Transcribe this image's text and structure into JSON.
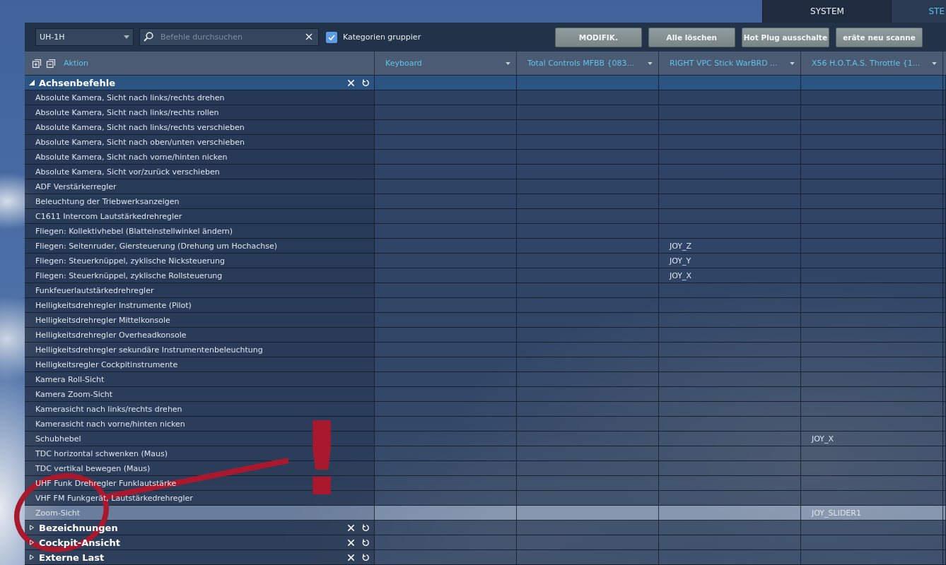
{
  "top_tabs": [
    {
      "label": "SYSTEM",
      "selected": false
    },
    {
      "label": "STE",
      "selected": true
    }
  ],
  "toolbar": {
    "aircraft": "UH-1H",
    "search": {
      "placeholder": "Befehle durchsuchen"
    },
    "group_categories": {
      "label": "Kategorien gruppier",
      "checked": true
    },
    "buttons": [
      "MODIFIK.",
      "Alle löschen",
      "Hot Plug ausschalte",
      "eräte neu scanne"
    ]
  },
  "table": {
    "columns": [
      {
        "label": "Aktion",
        "kind": "action"
      },
      {
        "label": "Keyboard",
        "kind": "device"
      },
      {
        "label": "Total Controls MFBB {083...",
        "kind": "device"
      },
      {
        "label": "RIGHT VPC Stick WarBRD ...",
        "kind": "device"
      },
      {
        "label": "X56 H.O.T.A.S. Throttle {1...",
        "kind": "device"
      }
    ],
    "categories": [
      {
        "name": "Achsenbefehle",
        "expanded": true,
        "rows": [
          {
            "action": "Absolute Kamera, Sicht nach links/rechts drehen",
            "selected": false
          },
          {
            "action": "Absolute Kamera, Sicht nach links/rechts rollen",
            "selected": false
          },
          {
            "action": "Absolute Kamera, Sicht nach links/rechts verschieben",
            "selected": false
          },
          {
            "action": "Absolute Kamera, Sicht nach oben/unten verschieben",
            "selected": false
          },
          {
            "action": "Absolute Kamera, Sicht nach vorne/hinten nicken",
            "selected": false
          },
          {
            "action": "Absolute Kamera, Sicht vor/zurück verschieben",
            "selected": false
          },
          {
            "action": "ADF Verstärkerregler",
            "selected": false
          },
          {
            "action": "Beleuchtung der Triebwerksanzeigen",
            "selected": false
          },
          {
            "action": "C1611 Intercom Lautstärkedrehregler",
            "selected": false
          },
          {
            "action": "Fliegen: Kollektivhebel (Blatteinstellwinkel ändern)",
            "selected": false
          },
          {
            "action": "Fliegen: Seitenruder, Giersteuerung (Drehung um Hochachse)",
            "selected": false,
            "bindings": [
              {
                "kind": "none"
              },
              {
                "kind": "none"
              },
              {
                "kind": "binding",
                "value": "JOY_Z"
              },
              {
                "kind": "none"
              }
            ]
          },
          {
            "action": "Fliegen: Steuerknüppel, zyklische Nicksteuerung",
            "selected": false,
            "bindings": [
              {
                "kind": "none"
              },
              {
                "kind": "none"
              },
              {
                "kind": "binding",
                "value": "JOY_Y"
              },
              {
                "kind": "none"
              }
            ]
          },
          {
            "action": "Fliegen: Steuerknüppel, zyklische Rollsteuerung",
            "selected": false,
            "bindings": [
              {
                "kind": "none"
              },
              {
                "kind": "none"
              },
              {
                "kind": "binding",
                "value": "JOY_X"
              },
              {
                "kind": "none"
              }
            ]
          },
          {
            "action": "Funkfeuerlautstärkedrehregler",
            "selected": false
          },
          {
            "action": "Helligkeitsdrehregler Instrumente (Pilot)",
            "selected": false
          },
          {
            "action": "Helligkeitsdrehregler Mittelkonsole",
            "selected": false
          },
          {
            "action": "Helligkeitsdrehregler Overheadkonsole",
            "selected": false
          },
          {
            "action": "Helligkeitsdrehregler sekundäre Instrumentenbeleuchtung",
            "selected": false
          },
          {
            "action": "Helligkeitsregler Cockpitinstrumente",
            "selected": false
          },
          {
            "action": "Kamera Roll-Sicht",
            "selected": false
          },
          {
            "action": "Kamera Zoom-Sicht",
            "selected": false
          },
          {
            "action": "Kamerasicht nach links/rechts drehen",
            "selected": false
          },
          {
            "action": "Kamerasicht nach vorne/hinten nicken",
            "selected": false
          },
          {
            "action": "Schubhebel",
            "selected": false,
            "bindings": [
              {
                "kind": "none"
              },
              {
                "kind": "none"
              },
              {
                "kind": "none"
              },
              {
                "kind": "binding",
                "value": "JOY_X"
              }
            ]
          },
          {
            "action": "TDC horizontal schwenken (Maus)",
            "selected": false
          },
          {
            "action": "TDC vertikal bewegen (Maus)",
            "selected": false
          },
          {
            "action": "UHF Funk Drehregler Funklautstärke",
            "selected": false
          },
          {
            "action": "VHF FM Funkgerät, Lautstärkedrehregler",
            "selected": false
          },
          {
            "action": "Zoom-Sicht",
            "selected": true,
            "bindings": [
              {
                "kind": "none"
              },
              {
                "kind": "none"
              },
              {
                "kind": "none"
              },
              {
                "kind": "binding",
                "value": "JOY_SLIDER1"
              }
            ]
          }
        ]
      },
      {
        "name": "Bezeichnungen",
        "expanded": false
      },
      {
        "name": "Cockpit-Ansicht",
        "expanded": false
      },
      {
        "name": "Externe Last",
        "expanded": false
      }
    ]
  },
  "annotation": {
    "mark": "!"
  }
}
